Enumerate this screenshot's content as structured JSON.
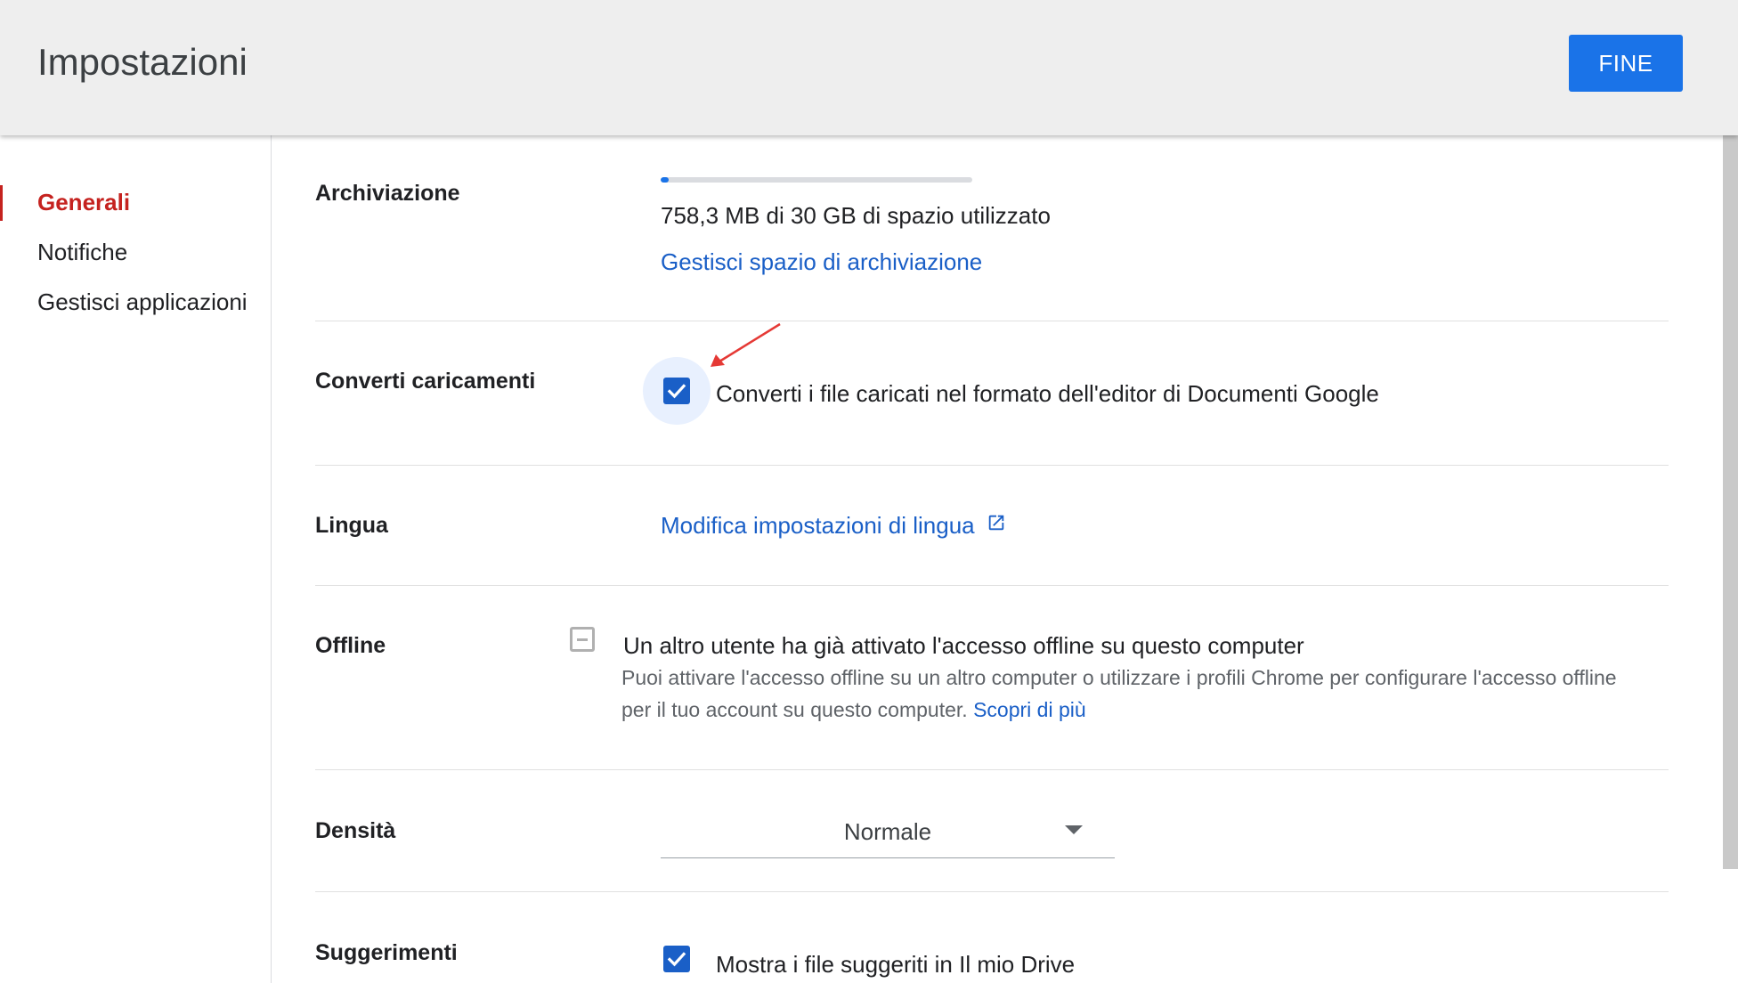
{
  "header": {
    "title": "Impostazioni",
    "done_label": "FINE"
  },
  "sidebar": {
    "items": [
      {
        "label": "Generali",
        "active": true
      },
      {
        "label": "Notifiche",
        "active": false
      },
      {
        "label": "Gestisci applicazioni",
        "active": false
      }
    ]
  },
  "storage": {
    "label": "Archiviazione",
    "used_fraction": 0.025,
    "usage_text": "758,3 MB di 30 GB di spazio utilizzato",
    "manage_link": "Gestisci spazio di archiviazione"
  },
  "convert": {
    "label": "Converti caricamenti",
    "checked": true,
    "text": "Converti i file caricati nel formato dell'editor di Documenti Google"
  },
  "language": {
    "label": "Lingua",
    "link": "Modifica impostazioni di lingua",
    "icon": "open-in-new-icon"
  },
  "offline": {
    "label": "Offline",
    "checked": false,
    "disabled": true,
    "title": "Un altro utente ha già attivato l'accesso offline su questo computer",
    "help_line1": "Puoi attivare l'accesso offline su un altro computer o utilizzare i profili Chrome per configurare l'accesso offline",
    "help_line2": "per il tuo account su questo computer.",
    "learn_more": "Scopri di più"
  },
  "density": {
    "label": "Densità",
    "selected": "Normale"
  },
  "suggestions": {
    "label": "Suggerimenti",
    "checked": true,
    "text": "Mostra i file suggeriti in Il mio Drive"
  },
  "colors": {
    "accent": "#1a73e8",
    "link": "#1a5fc7",
    "active_nav": "#c5221f",
    "annotation_arrow": "#e53935"
  }
}
